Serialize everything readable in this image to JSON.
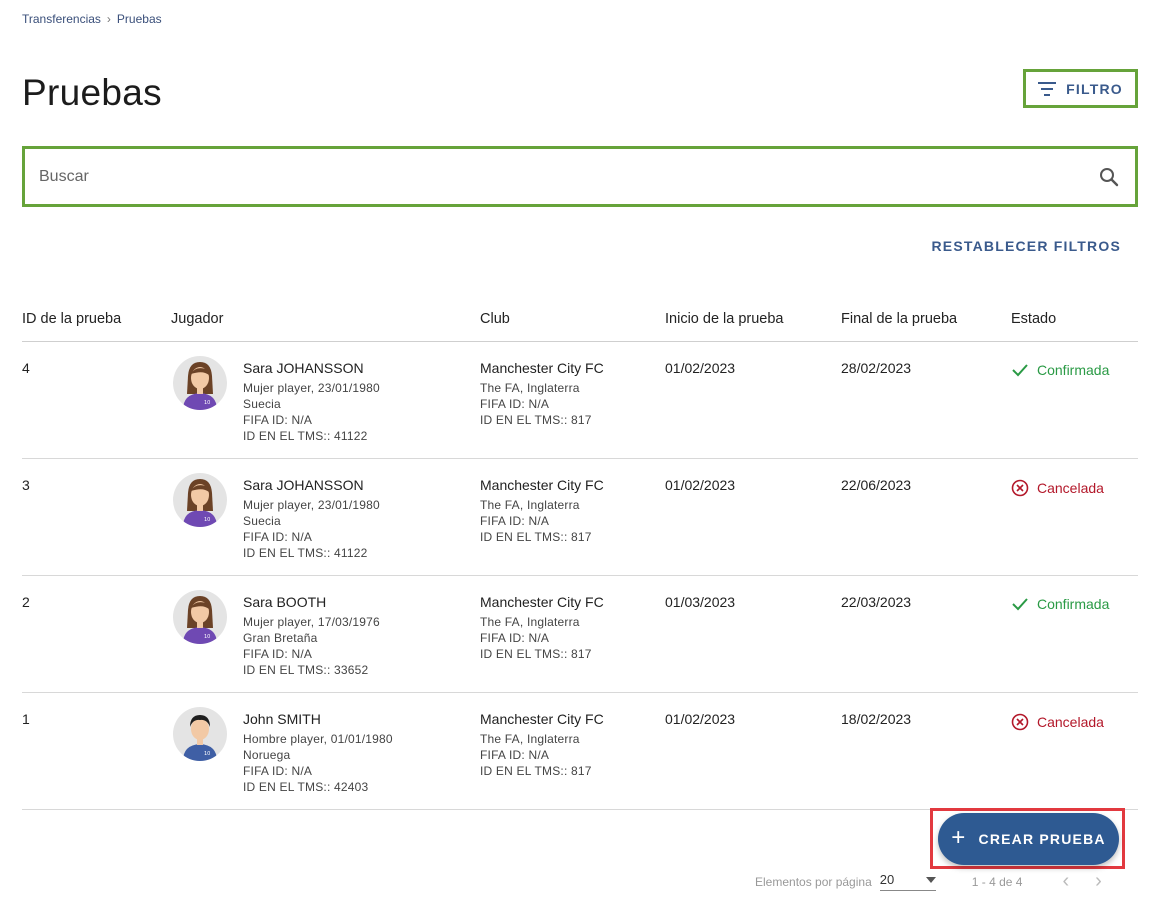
{
  "breadcrumb": {
    "items": [
      "Transferencias",
      "Pruebas"
    ],
    "separator": "›"
  },
  "page": {
    "title": "Pruebas"
  },
  "toolbar": {
    "filter_label": "FILTRO",
    "reset_label": "RESTABLECER FILTROS"
  },
  "search": {
    "placeholder": "Buscar",
    "value": ""
  },
  "table": {
    "headers": [
      "ID de la prueba",
      "Jugador",
      "Club",
      "Inicio de la prueba",
      "Final de la prueba",
      "Estado"
    ],
    "rows": [
      {
        "id": "4",
        "player": {
          "name": "Sara JOHANSSON",
          "info": "Mujer player, 23/01/1980",
          "country": "Suecia",
          "fifa": "FIFA ID: N/A",
          "tms": "ID EN EL TMS:: 41122",
          "avatar": "female"
        },
        "club": {
          "name": "Manchester City FC",
          "assoc": "The FA, Inglaterra",
          "fifa": "FIFA ID: N/A",
          "tms": "ID EN EL TMS:: 817"
        },
        "start": "01/02/2023",
        "end": "28/02/2023",
        "status": "Confirmada",
        "status_type": "ok"
      },
      {
        "id": "3",
        "player": {
          "name": "Sara JOHANSSON",
          "info": "Mujer player, 23/01/1980",
          "country": "Suecia",
          "fifa": "FIFA ID: N/A",
          "tms": "ID EN EL TMS:: 41122",
          "avatar": "female"
        },
        "club": {
          "name": "Manchester City FC",
          "assoc": "The FA, Inglaterra",
          "fifa": "FIFA ID: N/A",
          "tms": "ID EN EL TMS:: 817"
        },
        "start": "01/02/2023",
        "end": "22/06/2023",
        "status": "Cancelada",
        "status_type": "bad"
      },
      {
        "id": "2",
        "player": {
          "name": "Sara BOOTH",
          "info": "Mujer player, 17/03/1976",
          "country": "Gran Bretaña",
          "fifa": "FIFA ID: N/A",
          "tms": "ID EN EL TMS:: 33652",
          "avatar": "female"
        },
        "club": {
          "name": "Manchester City FC",
          "assoc": "The FA, Inglaterra",
          "fifa": "FIFA ID: N/A",
          "tms": "ID EN EL TMS:: 817"
        },
        "start": "01/03/2023",
        "end": "22/03/2023",
        "status": "Confirmada",
        "status_type": "ok"
      },
      {
        "id": "1",
        "player": {
          "name": "John SMITH",
          "info": "Hombre player, 01/01/1980",
          "country": "Noruega",
          "fifa": "FIFA ID: N/A",
          "tms": "ID EN EL TMS:: 42403",
          "avatar": "male"
        },
        "club": {
          "name": "Manchester City FC",
          "assoc": "The FA, Inglaterra",
          "fifa": "FIFA ID: N/A",
          "tms": "ID EN EL TMS:: 817"
        },
        "start": "01/02/2023",
        "end": "18/02/2023",
        "status": "Cancelada",
        "status_type": "bad"
      }
    ]
  },
  "create": {
    "label": "CREAR PRUEBA",
    "icon": "plus-icon"
  },
  "pagination": {
    "per_page_label": "Elementos por página",
    "per_page": "20",
    "range": "1 - 4 de 4"
  },
  "colors": {
    "accent": "#2e5a92",
    "confirmed": "#2a9a45",
    "cancelled": "#b3182a",
    "highlight_green": "#66a33a",
    "highlight_red": "#e2393f"
  }
}
